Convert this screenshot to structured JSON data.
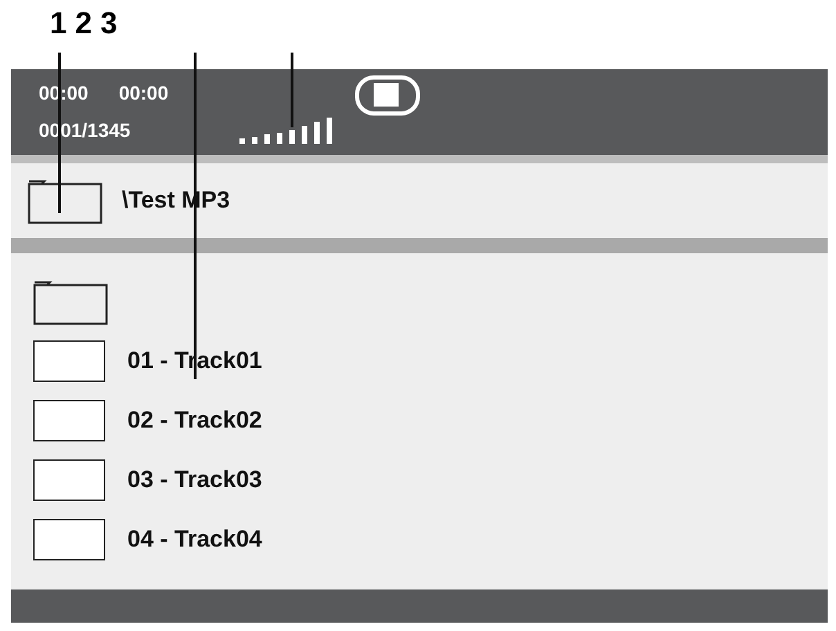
{
  "callouts": [
    "1",
    "2",
    "3"
  ],
  "status": {
    "elapsed": "00:00",
    "total": "00:00",
    "counter": "0001/1345"
  },
  "path": "\\Test MP3",
  "items": [
    {
      "kind": "folder"
    },
    {
      "kind": "file",
      "label": "01 - Track01"
    },
    {
      "kind": "file",
      "label": "02 - Track02"
    },
    {
      "kind": "file",
      "label": "03 - Track03"
    },
    {
      "kind": "file",
      "label": "04 - Track04"
    }
  ]
}
